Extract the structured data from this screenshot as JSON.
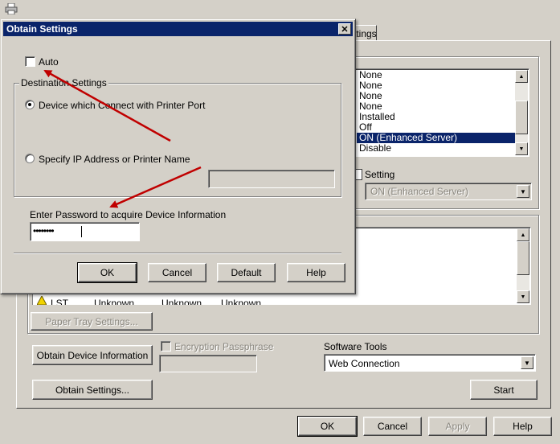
{
  "background_window": {
    "tab_partial_label": "ttings",
    "list_items": [
      "None",
      "None",
      "None",
      "None",
      "Installed",
      "Off",
      "ON (Enhanced Server)",
      "Disable"
    ],
    "selected_index": 6,
    "setting_label": "Setting",
    "setting_value": "ON (Enhanced Server)",
    "device_row": [
      "LST",
      "Unknown",
      "Unknown",
      "Unknown"
    ],
    "paper_tray_button": "Paper Tray Settings...",
    "obtain_device_info_button": "Obtain Device Information",
    "encryption_label": "Encryption Passphrase",
    "obtain_settings_button": "Obtain Settings...",
    "software_tools_label": "Software Tools",
    "software_tools_value": "Web Connection",
    "start_button": "Start",
    "ok_button": "OK",
    "cancel_button": "Cancel",
    "apply_button": "Apply",
    "help_button": "Help"
  },
  "dialog": {
    "title": "Obtain Settings",
    "close_glyph": "✕",
    "auto_label": "Auto",
    "auto_checked": false,
    "destination_group_label": "Destination Settings",
    "radio_printer_port_label": "Device which Connect with Printer Port",
    "radio_ip_label": "Specify IP Address or Printer Name",
    "selected_radio": "printer-port",
    "ip_value": "",
    "password_label": "Enter Password to acquire Device Information",
    "password_value": "••••••••",
    "ok_button": "OK",
    "cancel_button": "Cancel",
    "default_button": "Default",
    "help_button": "Help"
  },
  "icons": {
    "printer": "printer-icon",
    "close": "close-icon",
    "warning": "warning-icon",
    "arrow_up": "▲",
    "arrow_down": "▼"
  },
  "colors": {
    "titlebar": "#0a246a",
    "selection": "#0a246a",
    "face": "#d4d0c8",
    "annotation_arrow": "#c00000"
  }
}
